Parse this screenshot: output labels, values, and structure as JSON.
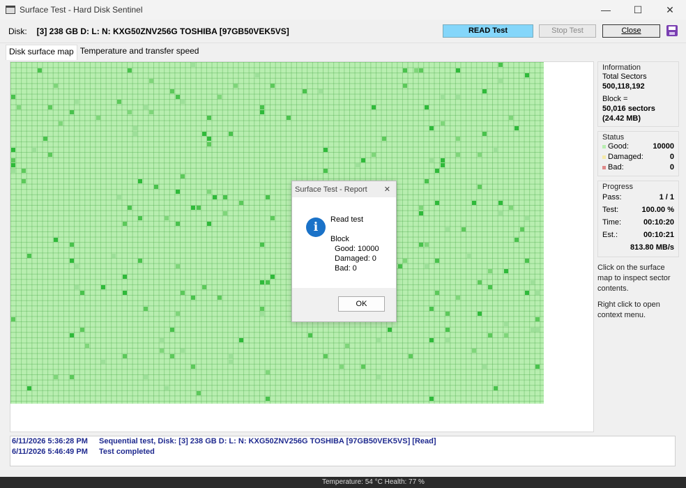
{
  "window": {
    "title": "Surface Test - Hard Disk Sentinel",
    "minimize": "—",
    "maximize": "☐",
    "close": "✕"
  },
  "toolbar": {
    "disk_label": "Disk:",
    "disk_value": "[3] 238 GB D: L: N: KXG50ZNV256G TOSHIBA [97GB50VEK5VS]",
    "read_test": "READ Test",
    "stop_test": "Stop Test",
    "close": "Close"
  },
  "tabs": [
    {
      "label": "Disk surface map"
    },
    {
      "label": "Temperature and transfer speed"
    }
  ],
  "information": {
    "title": "Information",
    "total_sectors_label": "Total Sectors",
    "total_sectors": "500,118,192",
    "block_label": "Block =",
    "block_sectors": "50,016 sectors",
    "block_size": "(24.42 MB)"
  },
  "status": {
    "title": "Status",
    "good_label": "Good:",
    "good": "10000",
    "damaged_label": "Damaged:",
    "damaged": "0",
    "bad_label": "Bad:",
    "bad": "0",
    "colors": {
      "good": "#b8eeb0",
      "damaged": "#f5e9a8",
      "bad": "#e08a8a"
    }
  },
  "progress": {
    "title": "Progress",
    "pass_label": "Pass:",
    "pass": "1 / 1",
    "test_label": "Test:",
    "test": "100.00 %",
    "time_label": "Time:",
    "time": "00:10:20",
    "est_label": "Est.:",
    "est": "00:10:21",
    "speed": "813.80 MB/s"
  },
  "hints": {
    "inspect": "Click on the surface map to inspect sector contents.",
    "context": "Right click to open context menu."
  },
  "dialog": {
    "title": "Surface Test - Report",
    "close": "✕",
    "icon": "i",
    "heading": "Read test",
    "block": "Block",
    "good": "Good: 10000",
    "damaged": "Damaged: 0",
    "bad": "Bad: 0",
    "ok": "OK"
  },
  "log": [
    {
      "time": "6/11/2026  5:36:28 PM",
      "message": "Sequential test, Disk: [3] 238 GB D: L: N: KXG50ZNV256G TOSHIBA [97GB50VEK5VS] [Read]"
    },
    {
      "time": "6/11/2026  5:46:49 PM",
      "message": "Test completed"
    }
  ],
  "statusbar": {
    "text": "Temperature: 54 °C   Health: 77 %"
  }
}
